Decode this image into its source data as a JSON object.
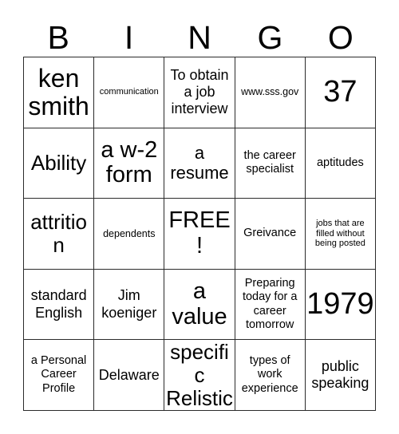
{
  "card": {
    "title_letters": [
      "B",
      "I",
      "N",
      "G",
      "O"
    ],
    "free_space_label": "FREE!",
    "grid_size": "5x5",
    "border_color": "#2b2b2b",
    "background_color": "#ffffff",
    "text_color": "#000000"
  },
  "rows": [
    [
      {
        "text": "ken smith",
        "size": "s-4xl"
      },
      {
        "text": "communication",
        "size": "s-xs"
      },
      {
        "text": "To obtain a job interview",
        "size": "s-lg"
      },
      {
        "text": "www.sss.gov",
        "size": "s-sm"
      },
      {
        "text": "37",
        "size": "s-5xl"
      }
    ],
    [
      {
        "text": "Ability",
        "size": "s-2xl"
      },
      {
        "text": "a w-2 form",
        "size": "s-3xl"
      },
      {
        "text": "a resume",
        "size": "s-xl"
      },
      {
        "text": "the career specialist",
        "size": "s-md"
      },
      {
        "text": "aptitudes",
        "size": "s-md"
      }
    ],
    [
      {
        "text": "attrition",
        "size": "s-2xl"
      },
      {
        "text": "dependents",
        "size": "s-sm"
      },
      {
        "text": "FREE!",
        "size": "s-3xl"
      },
      {
        "text": "Greivance",
        "size": "s-md"
      },
      {
        "text": "jobs that are filled without being posted",
        "size": "s-xs"
      }
    ],
    [
      {
        "text": "standard English",
        "size": "s-lg"
      },
      {
        "text": "Jim koeniger",
        "size": "s-lg"
      },
      {
        "text": "a value",
        "size": "s-3xl"
      },
      {
        "text": "Preparing today for a career tomorrow",
        "size": "s-md"
      },
      {
        "text": "1979",
        "size": "s-5xl"
      }
    ],
    [
      {
        "text": "a Personal Career Profile",
        "size": "s-md"
      },
      {
        "text": "Delaware",
        "size": "s-lg"
      },
      {
        "text": "specific Relistic",
        "size": "s-2xl"
      },
      {
        "text": "types of work experience",
        "size": "s-md"
      },
      {
        "text": "public speaking",
        "size": "s-lg"
      }
    ]
  ]
}
